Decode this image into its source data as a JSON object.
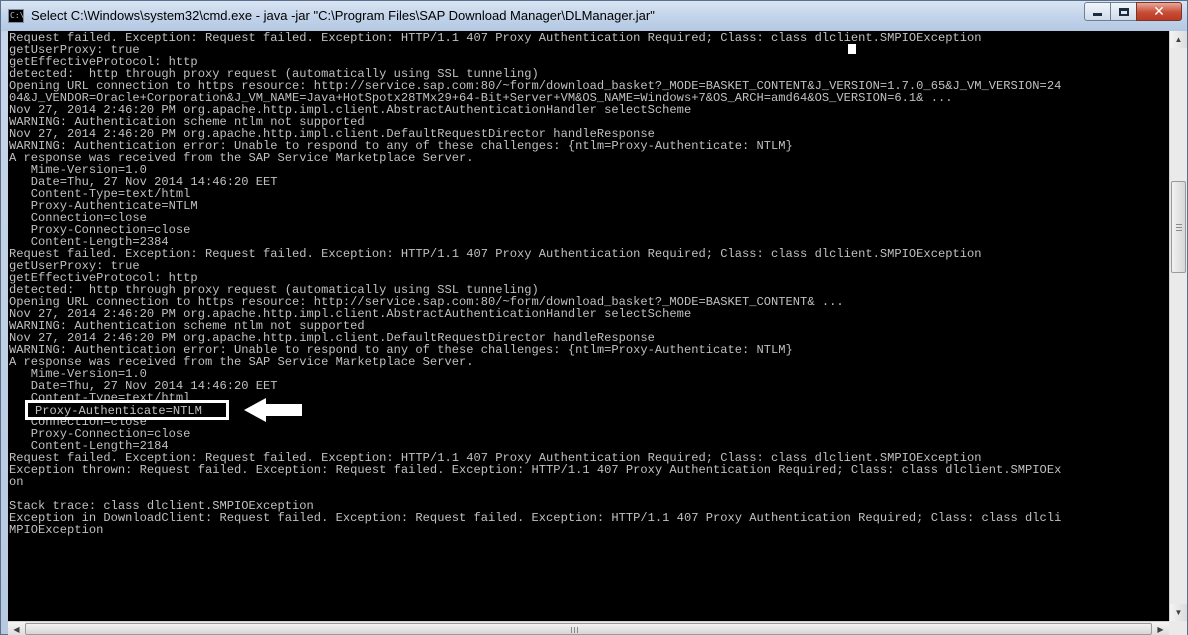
{
  "window": {
    "title": "Select C:\\Windows\\system32\\cmd.exe - java  -jar \"C:\\Program Files\\SAP Download Manager\\DLManager.jar\"",
    "icon": "cmd-icon",
    "icon_text": "C:\\",
    "controls": {
      "minimize": "minimize-icon",
      "maximize": "maximize-icon",
      "close": "close-icon",
      "close_glyph": "✕"
    }
  },
  "console": {
    "lines": [
      "Request failed. Exception: Request failed. Exception: HTTP/1.1 407 Proxy Authentication Required; Class: class dlclient.SMPIOException",
      "getUserProxy: true",
      "getEffectiveProtocol: http",
      "detected:  http through proxy request (automatically using SSL tunneling)",
      "Opening URL connection to https resource: http://service.sap.com:80/~form/download_basket?_MODE=BASKET_CONTENT&J_VERSION=1.7.0_65&J_VM_VERSION=24",
      "04&J_VENDOR=Oracle+Corporation&J_VM_NAME=Java+HotSpotx28TMx29+64-Bit+Server+VM&OS_NAME=Windows+7&OS_ARCH=amd64&OS_VERSION=6.1& ...",
      "Nov 27, 2014 2:46:20 PM org.apache.http.impl.client.AbstractAuthenticationHandler selectScheme",
      "WARNING: Authentication scheme ntlm not supported",
      "Nov 27, 2014 2:46:20 PM org.apache.http.impl.client.DefaultRequestDirector handleResponse",
      "WARNING: Authentication error: Unable to respond to any of these challenges: {ntlm=Proxy-Authenticate: NTLM}",
      "A response was received from the SAP Service Marketplace Server.",
      "   Mime-Version=1.0",
      "   Date=Thu, 27 Nov 2014 14:46:20 EET",
      "   Content-Type=text/html",
      "   Proxy-Authenticate=NTLM",
      "   Connection=close",
      "   Proxy-Connection=close",
      "   Content-Length=2384",
      "Request failed. Exception: Request failed. Exception: HTTP/1.1 407 Proxy Authentication Required; Class: class dlclient.SMPIOException",
      "getUserProxy: true",
      "getEffectiveProtocol: http",
      "detected:  http through proxy request (automatically using SSL tunneling)",
      "Opening URL connection to https resource: http://service.sap.com:80/~form/download_basket?_MODE=BASKET_CONTENT& ...",
      "Nov 27, 2014 2:46:20 PM org.apache.http.impl.client.AbstractAuthenticationHandler selectScheme",
      "WARNING: Authentication scheme ntlm not supported",
      "Nov 27, 2014 2:46:20 PM org.apache.http.impl.client.DefaultRequestDirector handleResponse",
      "WARNING: Authentication error: Unable to respond to any of these challenges: {ntlm=Proxy-Authenticate: NTLM}",
      "A response was received from the SAP Service Marketplace Server.",
      "   Mime-Version=1.0",
      "   Date=Thu, 27 Nov 2014 14:46:20 EET",
      "   Content-Type=text/html",
      "",
      "   Connection=close",
      "   Proxy-Connection=close",
      "   Content-Length=2184",
      "Request failed. Exception: Request failed. Exception: HTTP/1.1 407 Proxy Authentication Required; Class: class dlclient.SMPIOException",
      "Exception thrown: Request failed. Exception: Request failed. Exception: HTTP/1.1 407 Proxy Authentication Required; Class: class dlclient.SMPIOEx",
      "on",
      "",
      "Stack trace: class dlclient.SMPIOException",
      "Exception in DownloadClient: Request failed. Exception: Request failed. Exception: HTTP/1.1 407 Proxy Authentication Required; Class: class dlcli",
      "MPIOException"
    ],
    "highlighted_line": "Proxy-Authenticate=NTLM",
    "annotation_arrow": "left-arrow-icon"
  },
  "scrollbars": {
    "vertical": {
      "up": "▲",
      "down": "▼"
    },
    "horizontal": {
      "left": "◀",
      "right": "▶"
    }
  }
}
